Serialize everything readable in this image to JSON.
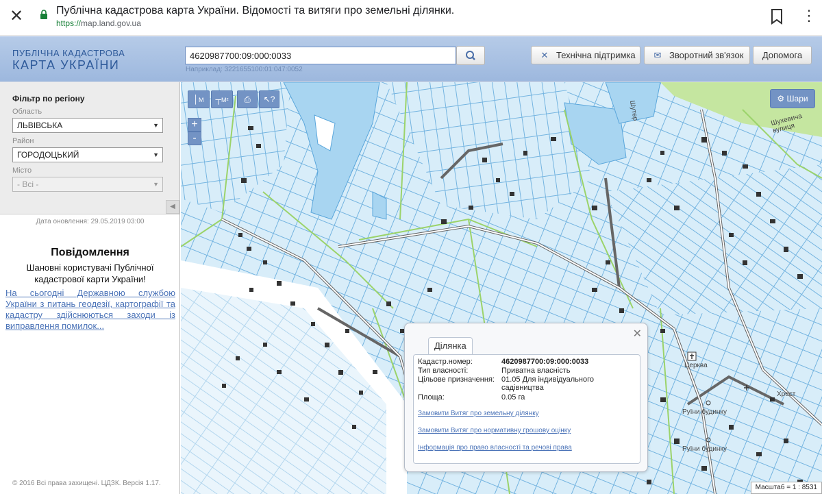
{
  "browser": {
    "title": "Публічна кадастрова карта України. Відомості та витяги про земельні ділянки.",
    "url_scheme": "https://",
    "url_host": "map.land.gov.ua",
    "close_glyph": "✕",
    "more_glyph": "⋮"
  },
  "header": {
    "logo_line1": "ПУБЛІЧНА КАДАСТРОВА",
    "logo_line2": "КАРТА УКРАЇНИ",
    "search_value": "4620987700:09:000:0033",
    "search_hint": "Наприклад: 3221655100:01:047:0052",
    "buttons": [
      {
        "label": "Технічна підтримка",
        "icon": "tools-icon"
      },
      {
        "label": "Зворотний зв'язок",
        "icon": "envelope-icon"
      },
      {
        "label": "Допомога"
      }
    ]
  },
  "sidebar": {
    "filter_title": "Фільтр по регіону",
    "region_label": "Область",
    "region_value": "ЛЬВІВСЬКА",
    "district_label": "Район",
    "district_value": "ГОРОДОЦЬКИЙ",
    "city_label": "Місто",
    "city_value": "- Всі -",
    "update_date": "Дата оновлення: 29.05.2019 03:00",
    "notice_title": "Повідомлення",
    "notice_text": "Шановні користувачі Публічної кадастрової карти України!",
    "notice_link": "На сьогодні Державною службою України з питань геодезії, картографії та кадастру здійснюються заходи із виправлення помилок...",
    "copyright": "© 2016 Всі права захищені. ЦДЗК. Версія 1.17."
  },
  "map": {
    "tools": [
      {
        "label": "М",
        "icon": "ruler-icon"
      },
      {
        "label": "М²",
        "icon": "area-measure-icon"
      },
      {
        "label": "",
        "icon": "print-icon"
      },
      {
        "label": "?",
        "icon": "identify-cursor-icon"
      }
    ],
    "zoom_in": "+",
    "zoom_out": "-",
    "layers_label": "Шари",
    "labels": {
      "shuter": "Шутер",
      "shukhevycha": "Шухевича вулиця",
      "tserkva": "Церква",
      "khrest": "Хрест",
      "ruiny1": "Руїни будинку",
      "ruiny2": "Руїни будинку"
    },
    "scale": "Масштаб = 1 : 8531",
    "colors": {
      "parcel_fill": "#d6ecf8",
      "parcel_line": "#6fb0df",
      "boundary": "#9bd36a",
      "water": "#a9d6f2",
      "building": "#333333"
    }
  },
  "popup": {
    "tab": "Ділянка",
    "rows": [
      {
        "k": "Кадастр.номер:",
        "v": "4620987700:09:000:0033"
      },
      {
        "k": "Тип власності:",
        "v": "Приватна власність"
      },
      {
        "k": "Цільове призначення:",
        "v": "01.05 Для індивідуального садівництва"
      },
      {
        "k": "Площа:",
        "v": "0.05 га"
      }
    ],
    "links": [
      "Замовити Витяг про земельну ділянку",
      "Замовити Витяг про нормативну грошову оцінку",
      "Інформація про право власності та речові права"
    ]
  }
}
